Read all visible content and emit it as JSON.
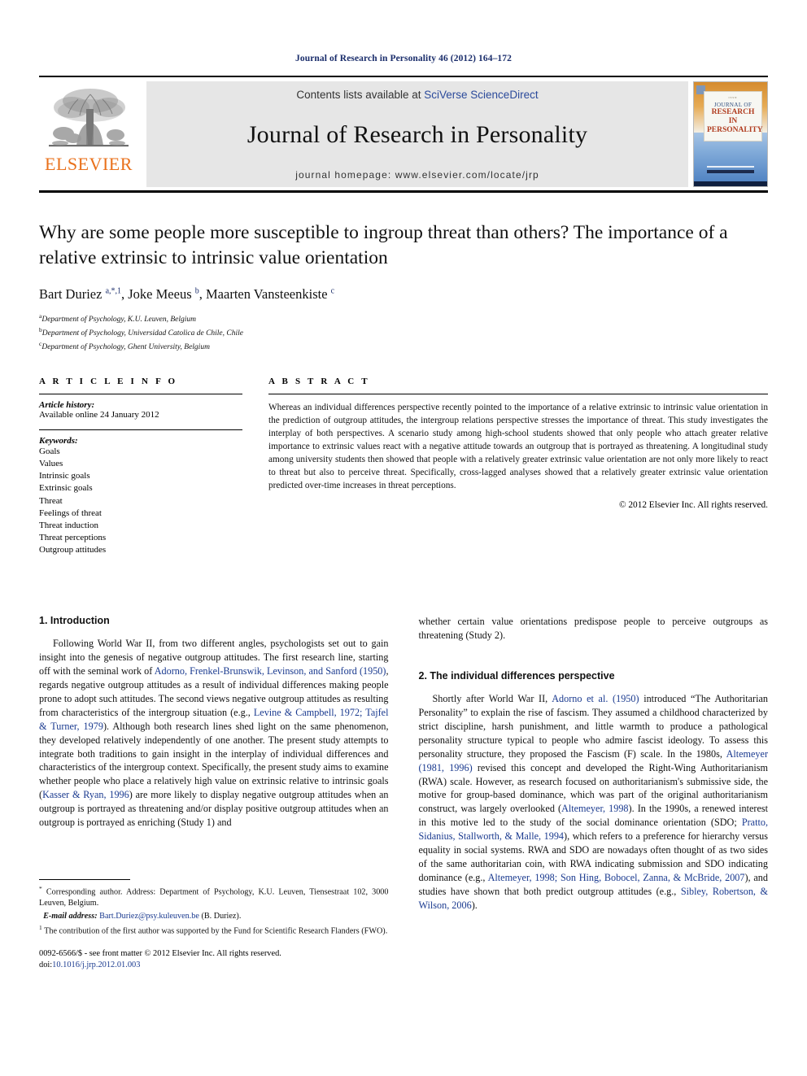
{
  "running_head": "Journal of Research in Personality 46 (2012) 164–172",
  "masthead": {
    "publisher_logo_text": "ELSEVIER",
    "contents_prefix": "Contents lists available at ",
    "contents_link": "SciVerse ScienceDirect",
    "journal_name": "Journal of Research in Personality",
    "homepage_line": "journal homepage: www.elsevier.com/locate/jrp",
    "cover": {
      "micro_top": "ISSN",
      "line1": "JOURNAL OF",
      "line2": "RESEARCH IN",
      "line3": "PERSONALITY"
    }
  },
  "article": {
    "title": "Why are some people more susceptible to ingroup threat than others? The importance of a relative extrinsic to intrinsic value orientation",
    "authors_html": "Bart Duriez <sup>a,*,1</sup>, Joke Meeus <sup>b</sup>, Maarten Vansteenkiste <sup>c</sup>",
    "affiliations": [
      {
        "marker": "a",
        "text": "Department of Psychology, K.U. Leuven, Belgium"
      },
      {
        "marker": "b",
        "text": "Department of Psychology, Universidad Catolica de Chile, Chile"
      },
      {
        "marker": "c",
        "text": "Department of Psychology, Ghent University, Belgium"
      }
    ]
  },
  "article_info": {
    "heading": "A R T I C L E   I N F O",
    "history_label": "Article history:",
    "history_value": "Available online 24 January 2012",
    "keywords_label": "Keywords:",
    "keywords": [
      "Goals",
      "Values",
      "Intrinsic goals",
      "Extrinsic goals",
      "Threat",
      "Feelings of threat",
      "Threat induction",
      "Threat perceptions",
      "Outgroup attitudes"
    ]
  },
  "abstract": {
    "heading": "A B S T R A C T",
    "text": "Whereas an individual differences perspective recently pointed to the importance of a relative extrinsic to intrinsic value orientation in the prediction of outgroup attitudes, the intergroup relations perspective stresses the importance of threat. This study investigates the interplay of both perspectives. A scenario study among high-school students showed that only people who attach greater relative importance to extrinsic values react with a negative attitude towards an outgroup that is portrayed as threatening. A longitudinal study among university students then showed that people with a relatively greater extrinsic value orientation are not only more likely to react to threat but also to perceive threat. Specifically, cross-lagged analyses showed that a relatively greater extrinsic value orientation predicted over-time increases in threat perceptions.",
    "copyright": "© 2012 Elsevier Inc. All rights reserved."
  },
  "sections": {
    "intro_heading": "1. Introduction",
    "intro_para_1": "Following World War II, from two different angles, psychologists set out to gain insight into the genesis of negative outgroup attitudes. The first research line, starting off with the seminal work of ",
    "intro_cite_1": "Adorno, Frenkel-Brunswik, Levinson, and Sanford (1950)",
    "intro_para_1b": ", regards negative outgroup attitudes as a result of individual differences making people prone to adopt such attitudes. The second views negative outgroup attitudes as resulting from characteristics of the intergroup situation (e.g., ",
    "intro_cite_2": "Levine & Campbell, 1972; Tajfel & Turner, 1979",
    "intro_para_1c": "). Although both research lines shed light on the same phenomenon, they developed relatively independently of one another. The present study attempts to integrate both traditions to gain insight in the interplay of individual differences and characteristics of the intergroup context. Specifically, the present study aims to examine whether people who place a relatively high value on extrinsic relative to intrinsic goals (",
    "intro_cite_3": "Kasser & Ryan, 1996",
    "intro_para_1d": ") are more likely to display negative outgroup attitudes when an outgroup is portrayed as threatening and/or display positive outgroup attitudes when an outgroup is portrayed as enriching (Study 1) and whether certain value orientations predispose people to perceive outgroups as threatening (Study 2).",
    "sec2_heading": "2. The individual differences perspective",
    "sec2_a": "Shortly after World War II, ",
    "sec2_cite_1": "Adorno et al. (1950)",
    "sec2_b": " introduced “The Authoritarian Personality” to explain the rise of fascism. They assumed a childhood characterized by strict discipline, harsh punishment, and little warmth to produce a pathological personality structure typical to people who admire fascist ideology. To assess this personality structure, they proposed the Fascism (F) scale. In the 1980s, ",
    "sec2_cite_2": "Altemeyer (1981, 1996)",
    "sec2_c": " revised this concept and developed the Right-Wing Authoritarianism (RWA) scale. However, as research focused on authoritarianism's submissive side, the motive for group-based dominance, which was part of the original authoritarianism construct, was largely overlooked (",
    "sec2_cite_3": "Altemeyer, 1998",
    "sec2_d": "). In the 1990s, a renewed interest in this motive led to the study of the social dominance orientation (SDO; ",
    "sec2_cite_4": "Pratto, Sidanius, Stallworth, & Malle, 1994",
    "sec2_e": "), which refers to a preference for hierarchy versus equality in social systems. RWA and SDO are nowadays often thought of as two sides of the same authoritarian coin, with RWA indicating submission and SDO indicating dominance (e.g., ",
    "sec2_cite_5": "Altemeyer, 1998; Son Hing, Bobocel, Zanna, & McBride, 2007",
    "sec2_f": "), and studies have shown that both predict outgroup attitudes (e.g., ",
    "sec2_cite_6": "Sibley, Robertson, & Wilson, 2006",
    "sec2_g": ")."
  },
  "footnotes": {
    "corresponding_marker": "*",
    "corresponding_text": "Corresponding author. Address: Department of Psychology, K.U. Leuven, Tiensestraat 102, 3000 Leuven, Belgium.",
    "email_label": "E-mail address:",
    "email_value": "Bart.Duriez@psy.kuleuven.be",
    "email_suffix": " (B. Duriez).",
    "note1_marker": "1",
    "note1_text": "The contribution of the first author was supported by the Fund for Scientific Research Flanders (FWO)."
  },
  "footer": {
    "issn_line": "0092-6566/$ - see front matter © 2012 Elsevier Inc. All rights reserved.",
    "doi_label": "doi:",
    "doi_value": "10.1016/j.jrp.2012.01.003"
  },
  "colors": {
    "link": "#1a3a8f",
    "elsevier_orange": "#E9711C",
    "running_head": "#1a2d6b",
    "banner_bg": "#e6e6e6"
  }
}
